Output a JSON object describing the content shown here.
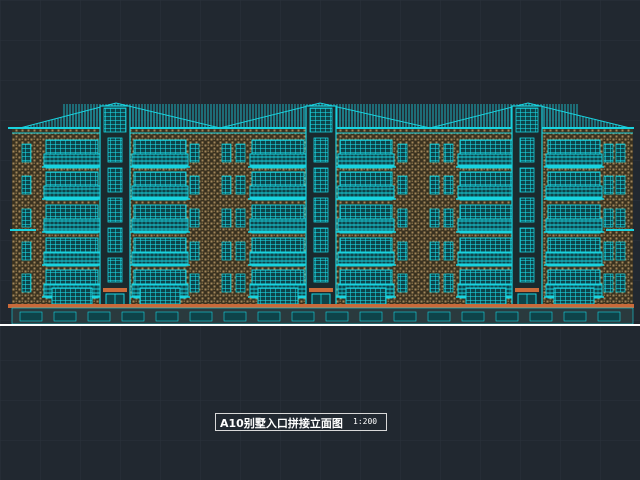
{
  "drawing": {
    "title": "A10别墅入口拼接立面图",
    "scale": "1:200"
  },
  "colors": {
    "background": "#212830",
    "grid": "#2b323b",
    "cyan": "#19d3df",
    "hatch": "#a2875a",
    "ground": "#ffffff",
    "base": "#c96a3a",
    "window_dark": "#0e4349",
    "door_green": "#28d84a"
  }
}
